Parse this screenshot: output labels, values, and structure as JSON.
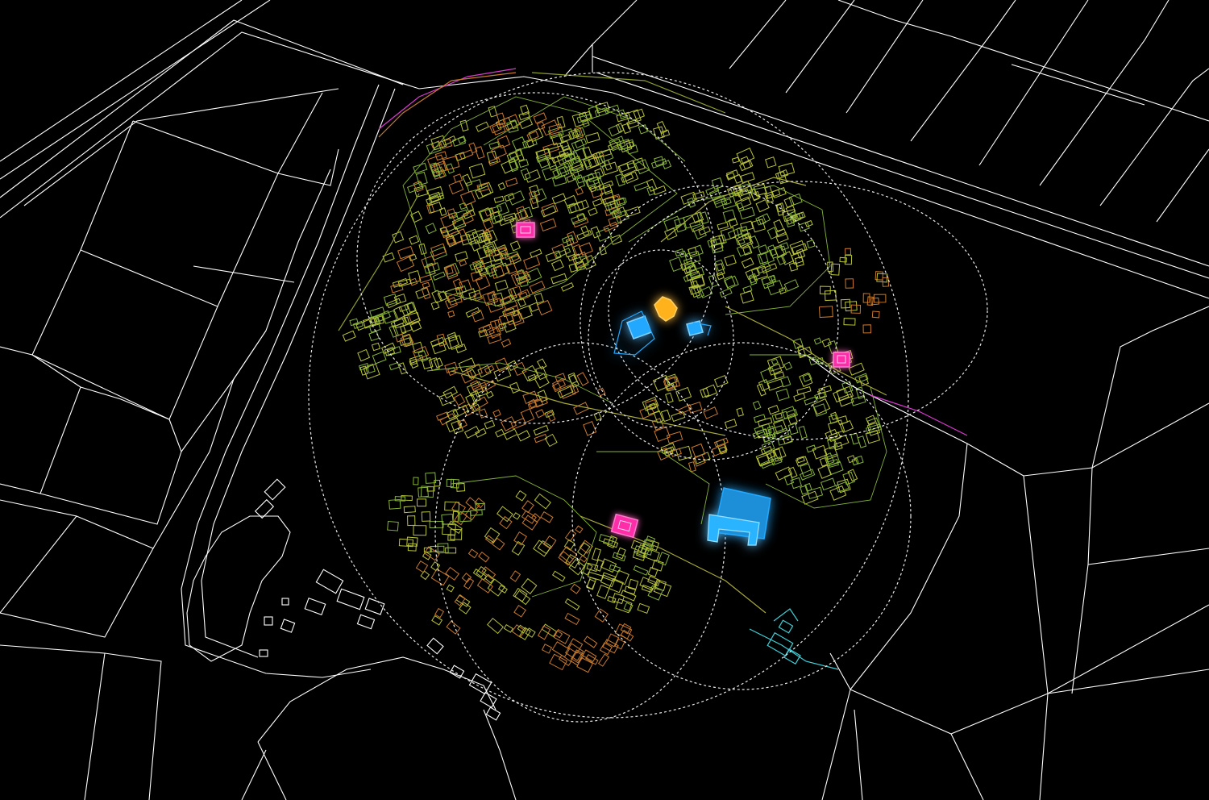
{
  "map": {
    "background_color": "#000000",
    "colors": {
      "parcel_lines": "#ffffff",
      "buildings_yellow_green": "#b8c23a",
      "buildings_green": "#86b23a",
      "buildings_orange": "#c77a2e",
      "coverage_rings": "#e8e8e8",
      "highlight_magenta": "#ff2fa8",
      "highlight_orange": "#ffb21e",
      "highlight_blue": "#23a9ff",
      "road_magenta": "#d93ccf",
      "road_cyan": "#3fd0d8"
    },
    "coverage_ring_count": 5,
    "highlighted_sites": [
      {
        "category": "magenta",
        "count": 3
      },
      {
        "category": "orange",
        "count": 1
      },
      {
        "category": "blue",
        "count": 3
      }
    ]
  }
}
